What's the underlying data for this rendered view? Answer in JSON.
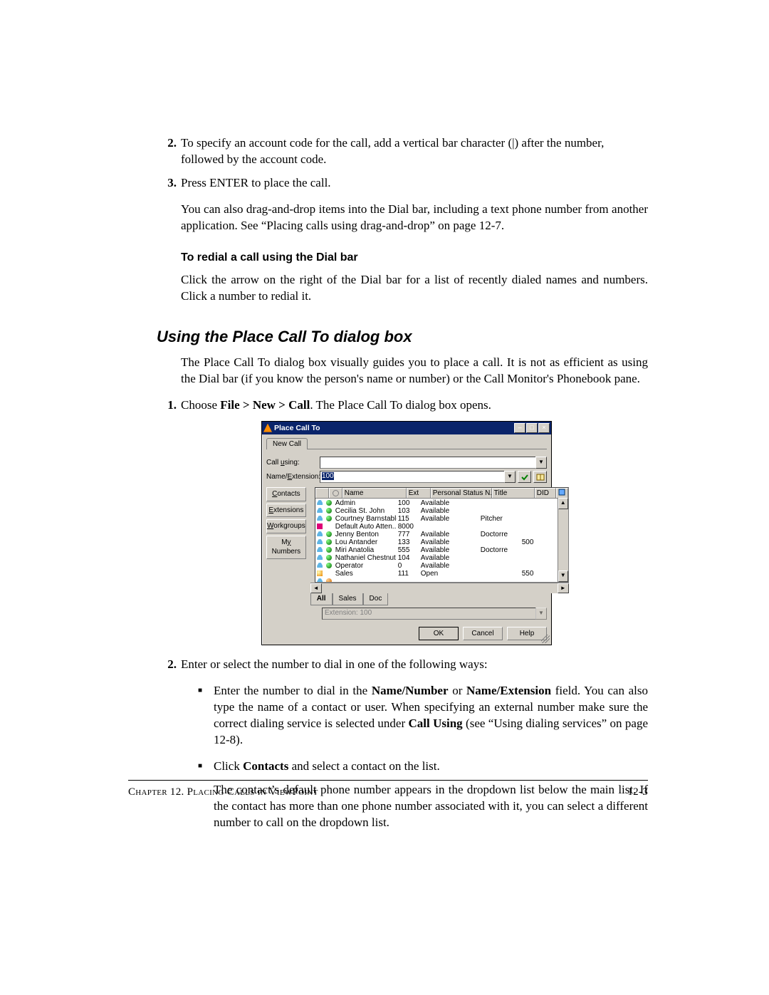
{
  "steps_top": [
    {
      "num": "2.",
      "text": "To specify an account code for the call, add a vertical bar character (|) after the number, followed by the account code."
    },
    {
      "num": "3.",
      "text": "Press ENTER to place the call."
    }
  ],
  "para_drag": "You can also drag-and-drop items into the Dial bar, including a text phone number from another application. See “Placing calls using drag-and-drop” on page 12-7.",
  "subhead_redial": "To redial a call using the Dial bar",
  "para_redial": "Click the arrow on the right of the Dial bar for a list of recently dialed names and numbers. Click a number to redial it.",
  "h2": "Using the Place Call To dialog box",
  "para_h2": "The Place Call To dialog box visually guides you to place a call. It is not as efficient as using the Dial bar (if you know the person's name or number) or the Call Monitor's Phonebook pane.",
  "steps_dialog": [
    {
      "num": "1.",
      "pre": "Choose ",
      "b": "File > New > Call",
      "post": ". The Place Call To dialog box opens."
    },
    {
      "num": "2.",
      "text": "Enter or select the number to dial in one of the following ways:"
    }
  ],
  "bullets": [
    {
      "pre": "Enter the number to dial in the ",
      "b1": "Name/Number",
      "mid": " or ",
      "b2": "Name/Extension",
      "post": " field. You can also type the name of a contact or user. When specifying an external number make sure the correct dialing service is selected under ",
      "b3": "Call Using",
      "post2": " (see “Using dialing services” on page 12-8)."
    },
    {
      "pre": "Click ",
      "b1": "Contacts",
      "post": " and select a contact on the list."
    }
  ],
  "bullet_follow": "The contact’s default phone number appears in the dropdown list below the main list. If the contact has more than one phone number associated with it, you can select a different number to call on the dropdown list.",
  "footer_left": "Chapter 12. Placing Calls in ViewPoint",
  "footer_right": "12-3",
  "dialog": {
    "title": "Place Call To",
    "tab": "New Call",
    "label_callusing": "Call using:",
    "label_nameext": "Name/Extension:",
    "nameext_value": "100",
    "nav": [
      "Contacts",
      "Extensions",
      "Workgroups",
      "My Numbers"
    ],
    "nav_underline_idx": [
      0,
      0,
      0,
      4
    ],
    "columns": [
      "",
      "",
      "Name",
      "Ext",
      "Personal Status N...",
      "Title",
      "DID"
    ],
    "rows": [
      {
        "i": "phone",
        "s": "green",
        "name": "Admin",
        "ext": "100",
        "psn": "Available",
        "title": "",
        "did": ""
      },
      {
        "i": "phone",
        "s": "green",
        "name": "Cecilia St. John",
        "ext": "103",
        "psn": "Available",
        "title": "",
        "did": ""
      },
      {
        "i": "phone",
        "s": "green",
        "name": "Courtney Barnstable",
        "ext": "115",
        "psn": "Available",
        "title": "Pitcher",
        "did": ""
      },
      {
        "i": "aa",
        "s": "",
        "name": "Default Auto Atten...",
        "ext": "8000",
        "psn": "",
        "title": "",
        "did": ""
      },
      {
        "i": "phone",
        "s": "green",
        "name": "Jenny Benton",
        "ext": "777",
        "psn": "Available",
        "title": "Doctorre",
        "did": ""
      },
      {
        "i": "phone",
        "s": "green",
        "name": "Lou Antander",
        "ext": "133",
        "psn": "Available",
        "title": "",
        "did": "500"
      },
      {
        "i": "phone",
        "s": "green",
        "name": "Miri Anatolia",
        "ext": "555",
        "psn": "Available",
        "title": "Doctorre",
        "did": ""
      },
      {
        "i": "phone",
        "s": "green",
        "name": "Nathaniel Chestnut",
        "ext": "104",
        "psn": "Available",
        "title": "",
        "did": ""
      },
      {
        "i": "phone",
        "s": "green",
        "name": "Operator",
        "ext": "0",
        "psn": "Available",
        "title": "",
        "did": ""
      },
      {
        "i": "op",
        "s": "",
        "name": "Sales",
        "ext": "111",
        "psn": "Open",
        "title": "",
        "did": "550"
      },
      {
        "i": "phone",
        "s": "orange",
        "name": "",
        "ext": "",
        "psn": "",
        "title": "",
        "did": ""
      }
    ],
    "bottom_tabs": [
      "All",
      "Sales",
      "Doc"
    ],
    "ext_label": "Extension:  100",
    "buttons": {
      "ok": "OK",
      "cancel": "Cancel",
      "help": "Help"
    }
  }
}
